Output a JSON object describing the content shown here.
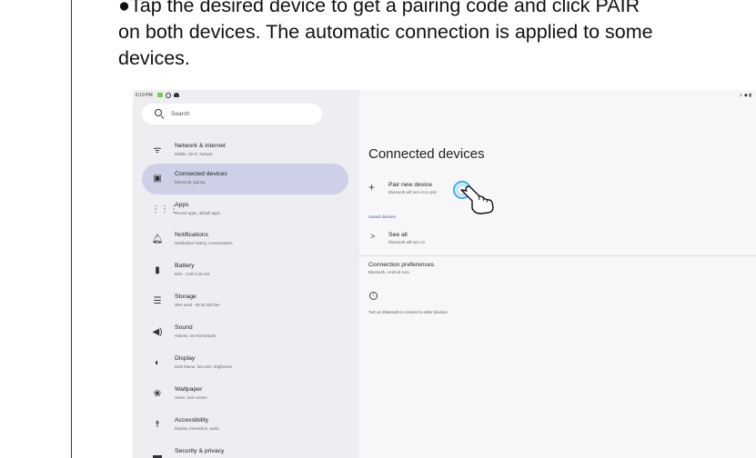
{
  "instruction": {
    "line1": "●Tap the desired device to get a pairing code and click PAIR",
    "line2": "on both devices. The automatic connection is applied to some",
    "line3": "devices."
  },
  "statusbar": {
    "time": "6:19 PM",
    "right_icons": "⇣ ◆ ▮"
  },
  "search": {
    "placeholder": "Search"
  },
  "sidebar": {
    "items": [
      {
        "title": "Network & internet",
        "subtitle": "Mobile, Wi-Fi, hotspot",
        "icon": "wifi-icon",
        "glyph": "ᯤ"
      },
      {
        "title": "Connected devices",
        "subtitle": "Bluetooth, pairing",
        "icon": "devices-icon",
        "glyph": "▣"
      },
      {
        "title": "Apps",
        "subtitle": "Recent apps, default apps",
        "icon": "apps-grid-icon",
        "glyph": "⋮⋮⋮"
      },
      {
        "title": "Notifications",
        "subtitle": "Notification history, conversations",
        "icon": "bell-icon",
        "glyph": "🔔︎"
      },
      {
        "title": "Battery",
        "subtitle": "62% · Until 5:15 AM",
        "icon": "battery-icon",
        "glyph": "▮"
      },
      {
        "title": "Storage",
        "subtitle": "26% used · 95.00 GB free",
        "icon": "storage-icon",
        "glyph": "☰"
      },
      {
        "title": "Sound",
        "subtitle": "Volume, Do Not Disturb",
        "icon": "speaker-icon",
        "glyph": "◀)"
      },
      {
        "title": "Display",
        "subtitle": "Dark theme, font size, brightness",
        "icon": "display-icon",
        "glyph": "◐"
      },
      {
        "title": "Wallpaper",
        "subtitle": "Home, lock screen",
        "icon": "palette-icon",
        "glyph": "❀"
      },
      {
        "title": "Accessibility",
        "subtitle": "Display, interaction, audio",
        "icon": "accessibility-icon",
        "glyph": "☨"
      },
      {
        "title": "Security & privacy",
        "subtitle": "",
        "icon": "lock-icon",
        "glyph": "▬"
      }
    ]
  },
  "main": {
    "title": "Connected devices",
    "pair": {
      "title": "Pair new device",
      "subtitle": "Bluetooth will turn on to pair"
    },
    "saved_label": "Saved devices",
    "see_all": {
      "title": "See all",
      "subtitle": "Bluetooth will turn on"
    },
    "preferences": {
      "title": "Connection preferences",
      "subtitle": "Bluetooth, Android Auto"
    },
    "info_text": "Turn on Bluetooth to connect to other devices."
  },
  "colors": {
    "active_bg": "#cdd0e6",
    "accent": "#4a55a8",
    "tap_ring": "#39a9e0"
  }
}
